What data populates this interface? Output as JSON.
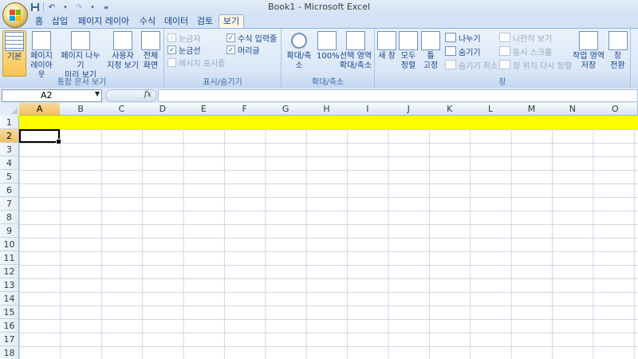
{
  "window": {
    "title": "Book1 - Microsoft Excel"
  },
  "tabs": [
    "홈",
    "삽입",
    "페이지 레이아웃",
    "수식",
    "데이터",
    "검토",
    "보기"
  ],
  "active_tab": "보기",
  "ribbon": {
    "groups": {
      "workbook_views": {
        "label": "통합 문서 보기",
        "normal": "기본",
        "page_layout": [
          "페이지",
          "레이아웃"
        ],
        "page_break": [
          "페이지 나누기",
          "미리 보기"
        ],
        "custom_views": [
          "사용자",
          "지정 보기"
        ],
        "full_screen": [
          "전체",
          "화면"
        ]
      },
      "show_hide": {
        "label": "표시/숨기기",
        "ruler": "눈금자",
        "gridlines": "눈금선",
        "message_bar": "메시지 표시줄",
        "formula_bar": "수식 입력줄",
        "headings": "머리글"
      },
      "zoom": {
        "label": "확대/축소",
        "zoom": "확대/축소",
        "hundred": "100%",
        "zoom_selection": [
          "선택 영역",
          "확대/축소"
        ]
      },
      "window": {
        "label": "창",
        "new_window": "새 창",
        "arrange_all": [
          "모두",
          "정렬"
        ],
        "freeze_panes": [
          "틀",
          "고정"
        ],
        "split": "나누기",
        "hide": "숨기기",
        "unhide": "숨기기 취소",
        "side_by_side": "나란히 보기",
        "sync_scroll": "동시 스크롤",
        "reset_position": "창 위치 다시 정렬",
        "save_workspace": [
          "작업 영역",
          "저장"
        ],
        "switch_windows": [
          "창",
          "전환"
        ]
      }
    }
  },
  "formula_bar": {
    "name_box": "A2",
    "fx": "fx",
    "value": ""
  },
  "sheet": {
    "columns": [
      "A",
      "B",
      "C",
      "D",
      "E",
      "F",
      "G",
      "H",
      "I",
      "J",
      "K",
      "L",
      "M",
      "N",
      "O"
    ],
    "rows": [
      "1",
      "2",
      "3",
      "4",
      "5",
      "6",
      "7",
      "8",
      "9",
      "10",
      "11",
      "12",
      "13",
      "14",
      "15",
      "16",
      "17",
      "18"
    ],
    "active_cell": "A2",
    "row1_fill": "#FFFF00"
  }
}
